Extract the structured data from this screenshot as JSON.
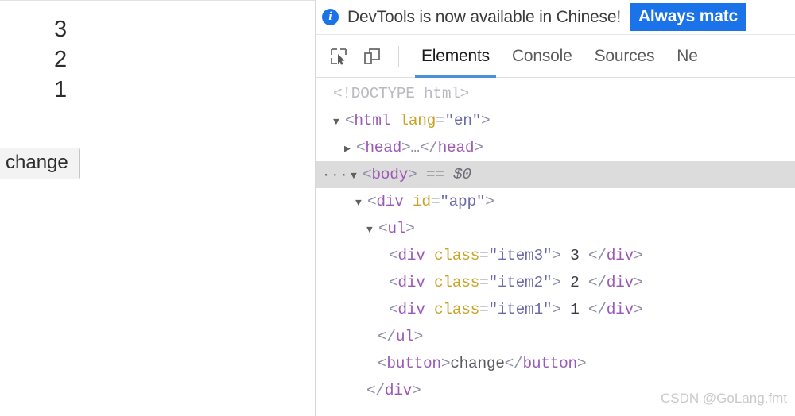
{
  "page": {
    "items": [
      "3",
      "2",
      "1"
    ],
    "button_label": "change"
  },
  "devtools": {
    "notification": {
      "icon": "info-icon",
      "message": "DevTools is now available in Chinese!",
      "action_label": "Always matc"
    },
    "toolbar": {
      "inspect_icon": "inspect-element-icon",
      "device_icon": "device-toolbar-icon",
      "tabs": [
        {
          "label": "Elements",
          "active": true
        },
        {
          "label": "Console",
          "active": false
        },
        {
          "label": "Sources",
          "active": false
        },
        {
          "label": "Ne",
          "active": false
        }
      ]
    },
    "dom_tree": {
      "rows": [
        {
          "type": "doctype",
          "indent": 1,
          "text": "<!DOCTYPE html>"
        },
        {
          "type": "open",
          "indent": 1,
          "tag": "html",
          "attr_name": "lang",
          "attr_value": "\"en\""
        },
        {
          "type": "collapsed",
          "indent": 2,
          "tag": "head",
          "ellipsis": "…"
        },
        {
          "type": "open-sel",
          "indent": 1,
          "tag": "body",
          "meta": "== $0",
          "dots": "···"
        },
        {
          "type": "open",
          "indent": 3,
          "tag": "div",
          "attr_name": "id",
          "attr_value": "\"app\""
        },
        {
          "type": "open",
          "indent": 4,
          "tag": "ul"
        },
        {
          "type": "leaf",
          "indent": 6,
          "tag": "div",
          "attr_name": "class",
          "attr_value": "\"item3\"",
          "text": "3"
        },
        {
          "type": "leaf",
          "indent": 6,
          "tag": "div",
          "attr_name": "class",
          "attr_value": "\"item2\"",
          "text": "2"
        },
        {
          "type": "leaf",
          "indent": 6,
          "tag": "div",
          "attr_name": "class",
          "attr_value": "\"item1\"",
          "text": "1"
        },
        {
          "type": "close",
          "indent": 5,
          "tag": "ul"
        },
        {
          "type": "leaf-plain",
          "indent": 5,
          "tag": "button",
          "text": "change"
        },
        {
          "type": "close",
          "indent": 4,
          "tag": "div"
        }
      ]
    }
  },
  "watermark": "CSDN @GoLang.fmt",
  "colors": {
    "accent_blue": "#1a73e8",
    "tab_underline": "#4a90d9",
    "selected_row": "#dcdcdc",
    "tag": "#9b59b6",
    "attr_name": "#c9a227",
    "attr_value": "#6b6ba8"
  }
}
